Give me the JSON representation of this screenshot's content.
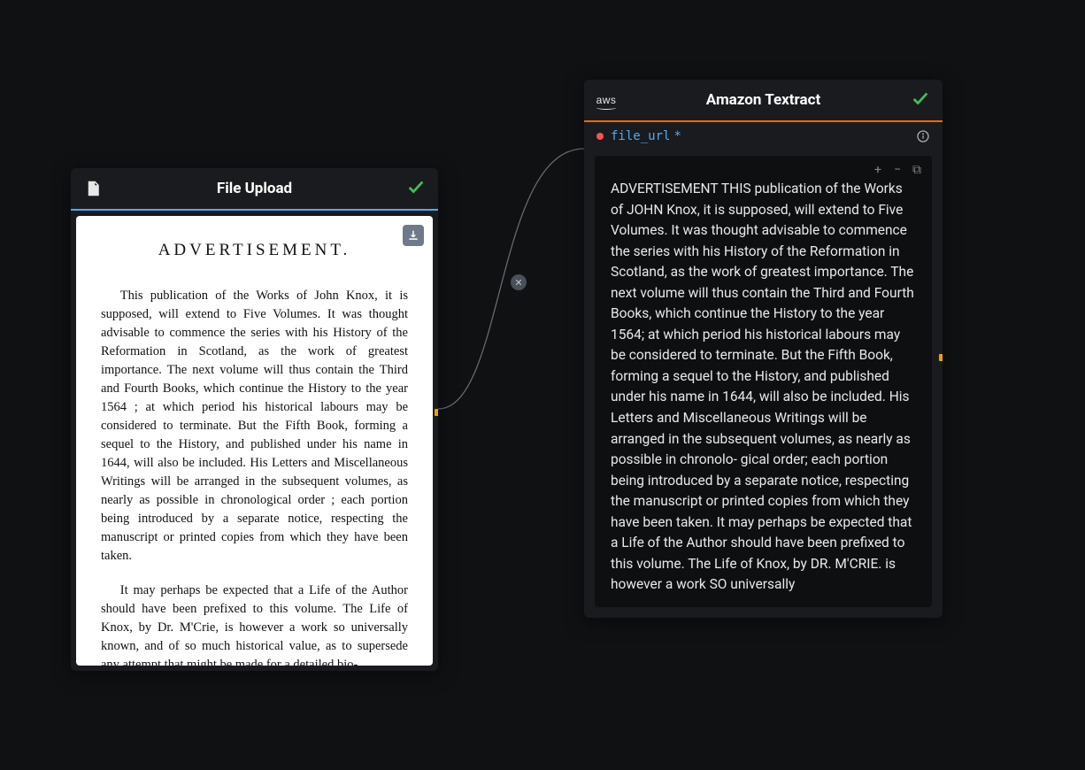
{
  "nodes": {
    "file_upload": {
      "title": "File Upload",
      "preview": {
        "heading": "ADVERTISEMENT.",
        "para1": "This publication of the Works of John Knox, it is supposed, will extend to Five Volumes.  It was thought advisable to commence the series with his History of the Reformation in Scotland, as the work of greatest importance.  The next volume will thus contain the Third and Fourth Books, which continue the History to the year 1564 ; at which period his historical labours may be considered to terminate.  But the Fifth Book, forming a sequel to the History, and published under his name in 1644, will also be included.  His Letters and Miscellaneous Writings will be arranged in the subsequent volumes, as nearly as possible in chronological order ; each portion being introduced by a separate notice, respecting the manuscript or printed copies from which they have been taken.",
        "para2": "It may perhaps be expected that a Life of the Author should have been prefixed to this volume.  The Life of Knox, by Dr. M'Crie, is however a work so universally known, and of so much historical value, as to supersede any attempt that might be made for a detailed bio-"
      }
    },
    "textract": {
      "title": "Amazon Textract",
      "vendor": "aws",
      "param": {
        "name": "file_url",
        "required_marker": "*"
      },
      "output": "ADVERTISEMENT THIS publication of the Works of JOHN Knox, it is supposed, will extend to Five Volumes. It was thought advisable to commence the series with his History of the Reformation in Scotland, as the work of greatest importance. The next volume will thus contain the Third and Fourth Books, which continue the History to the year 1564; at which period his historical labours may be considered to terminate. But the Fifth Book, forming a sequel to the History, and published under his name in 1644, will also be included. His Letters and Miscellaneous Writings will be arranged in the subsequent volumes, as nearly as possible in chronolo- gical order; each portion being introduced by a separate notice, respecting the manuscript or printed copies from which they have been taken. It may perhaps be expected that a Life of the Author should have been prefixed to this volume. The Life of Knox, by DR. M'CRIE. is however a work SO universally"
    }
  },
  "tools": {
    "plus": "+",
    "minus": "−",
    "copy": "⧉"
  }
}
